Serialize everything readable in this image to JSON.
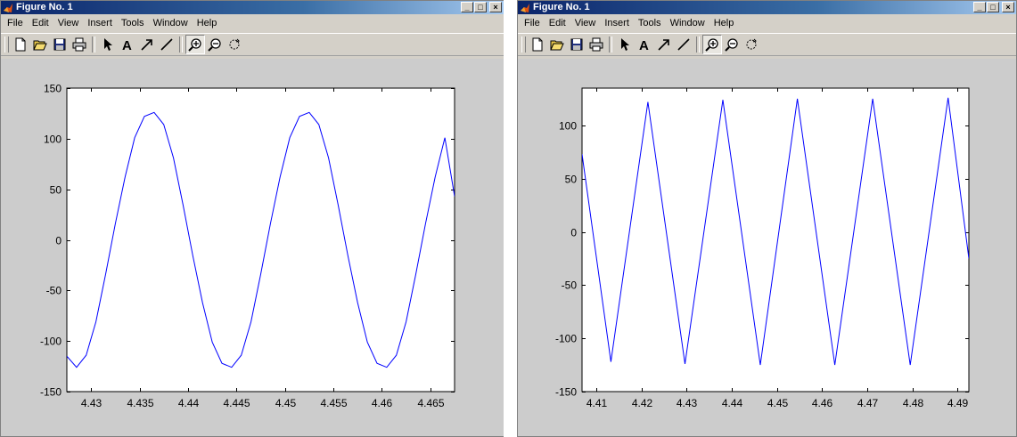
{
  "windows": [
    {
      "title": "Figure No. 1",
      "menu": [
        "File",
        "Edit",
        "View",
        "Insert",
        "Tools",
        "Window",
        "Help"
      ],
      "window_buttons": [
        "minimize",
        "maximize",
        "close"
      ],
      "toolbar": [
        {
          "name": "new-figure-icon"
        },
        {
          "name": "open-file-icon"
        },
        {
          "name": "save-icon"
        },
        {
          "name": "print-icon"
        },
        {
          "sep": true
        },
        {
          "name": "edit-plot-arrow-icon"
        },
        {
          "name": "insert-text-icon"
        },
        {
          "name": "insert-arrow-icon"
        },
        {
          "name": "insert-line-icon"
        },
        {
          "sep": true
        },
        {
          "name": "zoom-in-icon",
          "pressed": true
        },
        {
          "name": "zoom-out-icon"
        },
        {
          "name": "rotate-3d-icon"
        }
      ],
      "chart_data": {
        "type": "line",
        "xlim": [
          4.4275,
          4.4675
        ],
        "ylim": [
          -150,
          150
        ],
        "xticks": [
          4.43,
          4.435,
          4.44,
          4.445,
          4.45,
          4.455,
          4.46,
          4.465
        ],
        "xtick_labels": [
          "4.43",
          "4.435",
          "4.44",
          "4.445",
          "4.45",
          "4.455",
          "4.46",
          "4.465"
        ],
        "yticks": [
          -150,
          -100,
          -50,
          0,
          50,
          100,
          150
        ],
        "ytick_labels": [
          "-150",
          "-100",
          "-50",
          "0",
          "50",
          "100",
          "150"
        ],
        "series": [
          {
            "color": "#0000ff",
            "x": [
              4.4275,
              4.4285,
              4.4295,
              4.4305,
              4.4315,
              4.4325,
              4.4335,
              4.4345,
              4.4355,
              4.4365,
              4.4375,
              4.4385,
              4.4395,
              4.4405,
              4.4415,
              4.4425,
              4.4435,
              4.4445,
              4.4455,
              4.4465,
              4.4475,
              4.4485,
              4.4495,
              4.4505,
              4.4515,
              4.4525,
              4.4535,
              4.4545,
              4.4555,
              4.4565,
              4.4575,
              4.4585,
              4.4595,
              4.4605,
              4.4615,
              4.4625,
              4.4635,
              4.4645,
              4.4655,
              4.4665,
              4.4675
            ],
            "y": [
              -115,
              -126,
              -114,
              -81,
              -34,
              16,
              62,
              101,
              122,
              126,
              114,
              81,
              34,
              -16,
              -62,
              -101,
              -122,
              -126,
              -114,
              -81,
              -34,
              16,
              62,
              101,
              122,
              126,
              114,
              81,
              34,
              -16,
              -62,
              -101,
              -122,
              -126,
              -114,
              -81,
              -34,
              16,
              62,
              101,
              43
            ]
          }
        ]
      }
    },
    {
      "title": "Figure No. 1",
      "menu": [
        "File",
        "Edit",
        "View",
        "Insert",
        "Tools",
        "Window",
        "Help"
      ],
      "window_buttons": [
        "minimize",
        "maximize",
        "close"
      ],
      "toolbar": [
        {
          "name": "new-figure-icon"
        },
        {
          "name": "open-file-icon"
        },
        {
          "name": "save-icon"
        },
        {
          "name": "print-icon"
        },
        {
          "sep": true
        },
        {
          "name": "edit-plot-arrow-icon"
        },
        {
          "name": "insert-text-icon"
        },
        {
          "name": "insert-arrow-icon"
        },
        {
          "name": "insert-line-icon"
        },
        {
          "sep": true
        },
        {
          "name": "zoom-in-icon",
          "pressed": true
        },
        {
          "name": "zoom-out-icon"
        },
        {
          "name": "rotate-3d-icon"
        }
      ],
      "chart_data": {
        "type": "line",
        "xlim": [
          4.4068,
          4.4925
        ],
        "ylim": [
          -150,
          135
        ],
        "xticks": [
          4.41,
          4.42,
          4.43,
          4.44,
          4.45,
          4.46,
          4.47,
          4.48,
          4.49
        ],
        "xtick_labels": [
          "4.41",
          "4.42",
          "4.43",
          "4.44",
          "4.45",
          "4.46",
          "4.47",
          "4.48",
          "4.49"
        ],
        "yticks": [
          -150,
          -100,
          -50,
          0,
          50,
          100
        ],
        "ytick_labels": [
          "-150",
          "-100",
          "-50",
          "0",
          "50",
          "100"
        ],
        "series": [
          {
            "color": "#0000ff",
            "x": [
              4.4068,
              4.4132,
              4.4214,
              4.4296,
              4.438,
              4.4463,
              4.4545,
              4.4628,
              4.4712,
              4.4795,
              4.4879,
              4.4925
            ],
            "y": [
              73,
              -122,
              122,
              -124,
              124,
              -125,
              125,
              -125,
              125,
              -125,
              126,
              -25
            ]
          }
        ]
      }
    }
  ]
}
